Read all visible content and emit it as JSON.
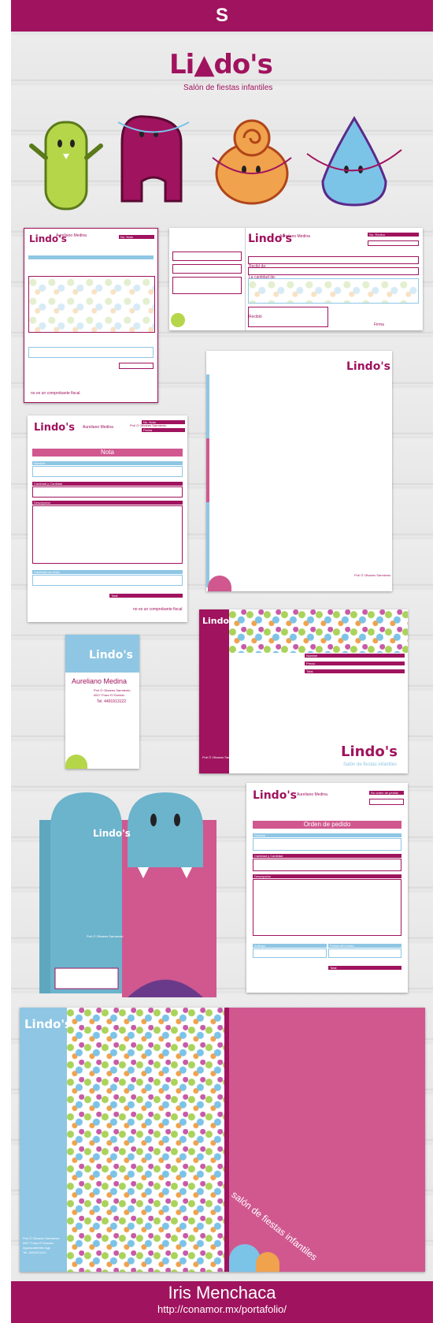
{
  "header": {
    "badge_glyph": "S",
    "accent": "#a0135e",
    "blue": "#8ec6e4",
    "pink": "#d0588f"
  },
  "brand": {
    "logo_text": "Lindo's",
    "logo_main": "Li",
    "logo_rest": "do's",
    "tagline": "Salón de fiestas infantiles"
  },
  "mascots": [
    "green-monster",
    "purple-monster",
    "orange-monster",
    "blue-monster"
  ],
  "contact": {
    "name": "Aureliano Medina",
    "address1": "Pról Ó Olivares Sarmiento",
    "address2": "#517 Fracc El Dorado",
    "city": "Aguascalientes Ags",
    "phone": "Tel. 4491913122"
  },
  "forms": {
    "no_nota": "No. Nota",
    "no_recibo": "No. Recibo",
    "no_pedido": "No orden de pedido",
    "fecha": "Fecha",
    "nota_title": "Nota",
    "orden_title": "Orden de pedido",
    "nombre": "Nombre",
    "cantidad": "Cantidad y Cantidad",
    "descripcion": "Descripción",
    "cantidad_letra": "Cantidad con letra",
    "total": "Total",
    "footer_fiscal": "no es un comprobante fiscal",
    "recibi_de": "Recibí de:",
    "la_cantidad": "La cantidad de:",
    "recibio": "Recibió",
    "firma": "Firma",
    "abono": "Abono",
    "precio": "Precio",
    "anticipo": "Anticipo",
    "fecha_evento": "Fecha del evento"
  },
  "folder": {
    "script_text": "salón de fiestas infantiles"
  },
  "footer": {
    "author": "Iris Menchaca",
    "url": "http://conamor.mx/portafolio/"
  }
}
